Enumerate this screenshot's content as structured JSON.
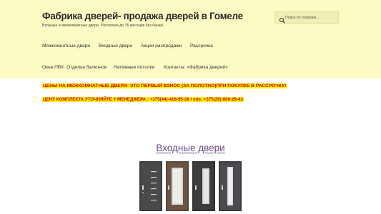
{
  "header": {
    "site_title": "Фабрика дверей- продажа дверей в Гомеле",
    "site_description": "Входные и межкомнатные двери. Рассрочка до 35 месяцев без банка!",
    "search_placeholder": "Поиск по товарам…",
    "search_icon": "search-icon"
  },
  "nav": {
    "items": [
      {
        "label": "Межкомнатные двери"
      },
      {
        "label": "Входные двери"
      },
      {
        "label": "Акции распродажи"
      },
      {
        "label": "Рассрочка"
      },
      {
        "label": "Окна ПВХ. Отделка балконов"
      },
      {
        "label": "Натяжные потолки"
      },
      {
        "label": "Контакты: «Фабрика дверей»"
      }
    ]
  },
  "main": {
    "promo_1": "ЦЕНЫ НА МЕЖКОМНАТНЫЕ ДВЕРИ- ЭТО ПЕРВЫЙ ВЗНОС (ЗА ПОЛОТНО)ПРИ ПОКУПКЕ В РАССРОЧКУ!",
    "promo_2": "ЦЕНУ КОМПЛЕКТА УТОЧНЯЙТЕ У МЕНЕДЖЕРА : +375(44)-418-95-28  / mts: +375(29)-806-29-43",
    "section_title": "Входные двери"
  },
  "colors": {
    "header_bg": "#fcfbc4",
    "promo_text": "#d10000",
    "promo_highlight": "#fdf100",
    "section_link": "#6c4a85"
  }
}
